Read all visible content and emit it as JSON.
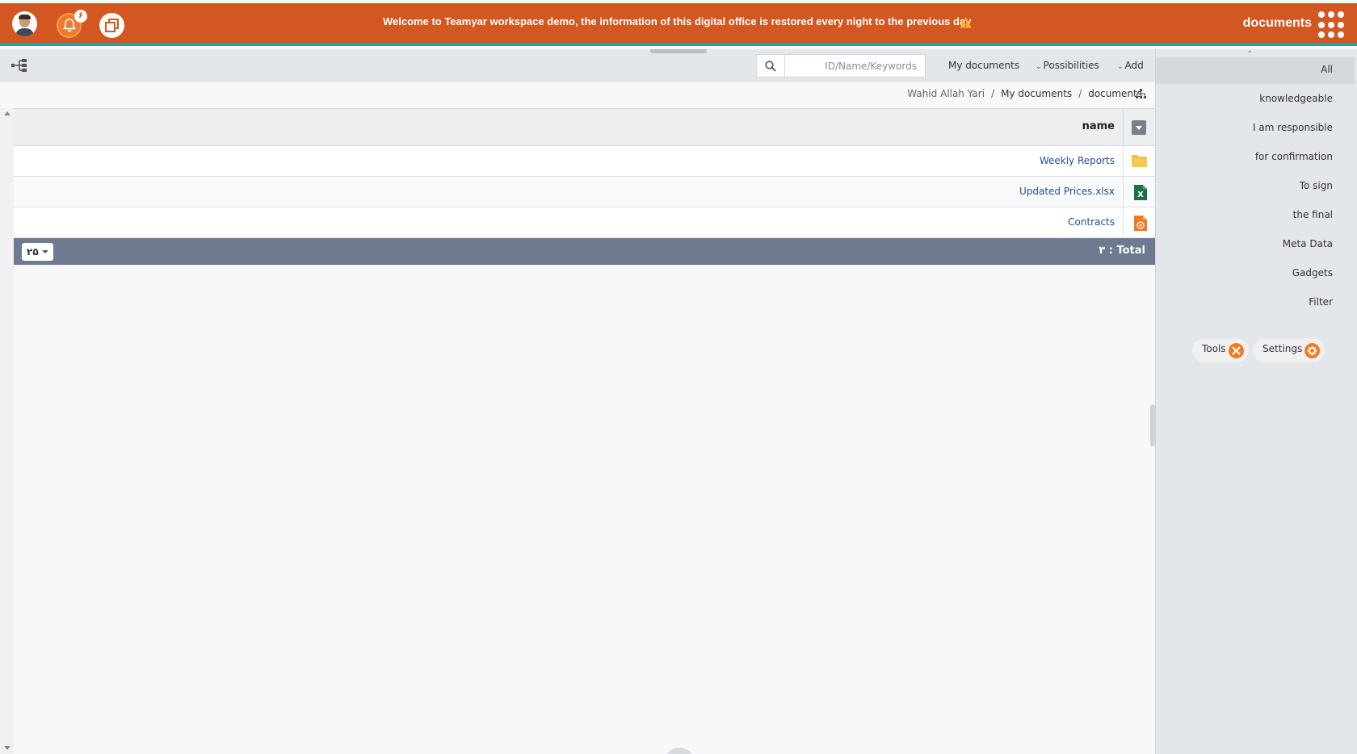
{
  "topbar": {
    "notification_count": "۶",
    "welcome_text": "Welcome to Teamyar workspace demo, the information of this digital office is restored every night to the previous day",
    "app_title": "documents"
  },
  "toolbar": {
    "search_placeholder": "ID/Name/Keywords",
    "my_documents": "My documents",
    "possibilities": "Possibilities",
    "add": "Add"
  },
  "breadcrumb": [
    "Wahid Allah Yari",
    "My documents",
    "documents"
  ],
  "table": {
    "header_name": "name",
    "rows": [
      {
        "name": "Weekly Reports",
        "icon": "folder-icon"
      },
      {
        "name": "Updated Prices.xlsx",
        "icon": "excel-file-icon"
      },
      {
        "name": "Contracts",
        "icon": "document-file-icon"
      }
    ],
    "total_label": ": Total",
    "total_value": "۳",
    "page_size": "۲۵"
  },
  "sidebar": {
    "items": [
      "All",
      "knowledgeable",
      "I am responsible",
      "for confirmation",
      "To sign",
      "the final",
      "Meta Data",
      "Gadgets",
      "Filter"
    ],
    "tools": "Tools",
    "settings": "Settings"
  },
  "colors": {
    "topbar": "#d35720",
    "accent_line": "#1aa3b3",
    "link": "#1f4e9c",
    "footer": "#6e7a8f"
  }
}
